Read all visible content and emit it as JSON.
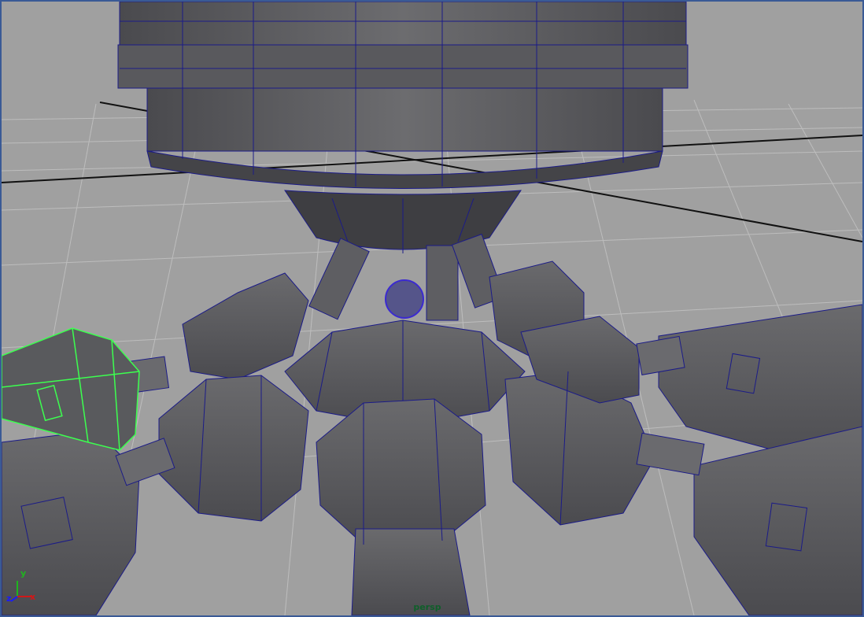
{
  "viewport": {
    "camera_name": "persp",
    "axes": {
      "x": "x",
      "y": "y",
      "z": "z"
    }
  },
  "colors": {
    "background": "#a0a0a0",
    "grid": "#bdbdbd",
    "grid_axis": "#111111",
    "mesh_fill": "#5a5a5e",
    "mesh_dark": "#3f3f43",
    "mesh_light": "#777779",
    "wireframe": "#1b1b88",
    "selection": "#3cff4f",
    "axis_x": "#d01818",
    "axis_y": "#1fb41f",
    "axis_z": "#1a1aff",
    "camera_label": "#0f5f2a"
  }
}
